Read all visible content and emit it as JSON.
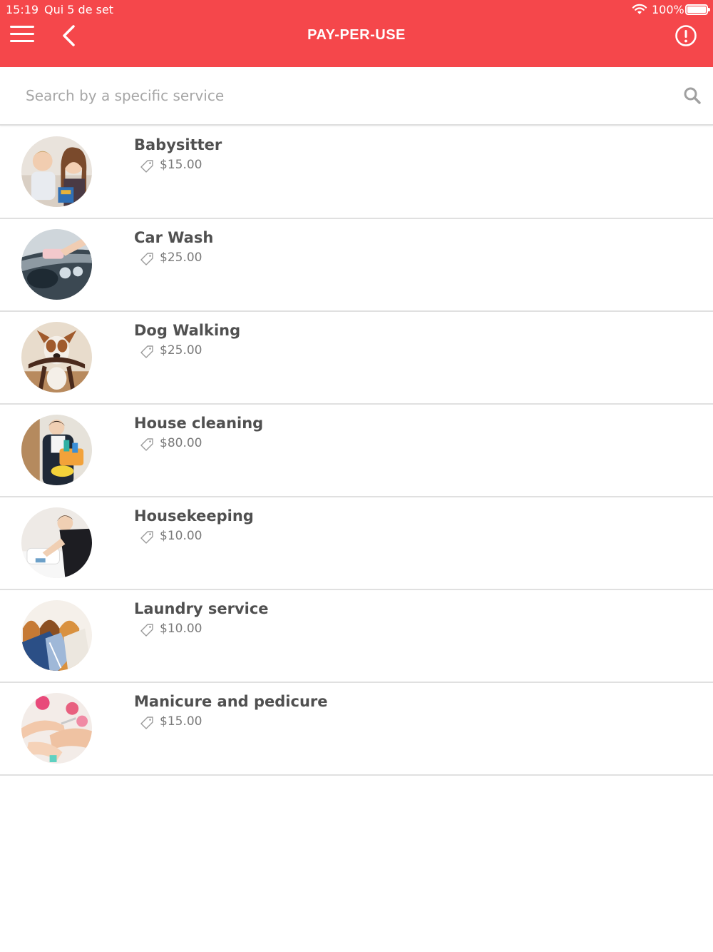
{
  "status_bar": {
    "time": "15:19",
    "date": "Qui 5 de set",
    "battery": "100%",
    "icons": [
      "wifi-icon",
      "battery-icon"
    ]
  },
  "header": {
    "title": "PAY-PER-USE",
    "background_color": "#f5474b",
    "icons": [
      "menu-icon",
      "back-chevron-icon",
      "alert-circle-icon"
    ]
  },
  "search": {
    "placeholder": "Search by a specific service",
    "value": "",
    "icon": "search-icon"
  },
  "services": [
    {
      "name": "Babysitter",
      "price": "$15.00",
      "image": "babysitter-photo",
      "tag_icon": "price-tag-icon"
    },
    {
      "name": "Car Wash",
      "price": "$25.00",
      "image": "car-wash-photo",
      "tag_icon": "price-tag-icon"
    },
    {
      "name": "Dog Walking",
      "price": "$25.00",
      "image": "dog-walking-photo",
      "tag_icon": "price-tag-icon"
    },
    {
      "name": "House cleaning",
      "price": "$80.00",
      "image": "house-cleaning-photo",
      "tag_icon": "price-tag-icon"
    },
    {
      "name": "Housekeeping",
      "price": "$10.00",
      "image": "housekeeping-photo",
      "tag_icon": "price-tag-icon"
    },
    {
      "name": "Laundry service",
      "price": "$10.00",
      "image": "laundry-photo",
      "tag_icon": "price-tag-icon"
    },
    {
      "name": "Manicure and pedicure",
      "price": "$15.00",
      "image": "manicure-photo",
      "tag_icon": "price-tag-icon"
    }
  ]
}
